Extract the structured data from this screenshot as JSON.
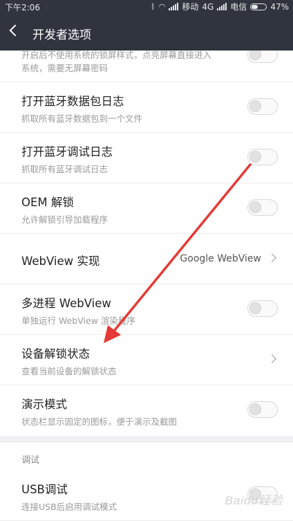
{
  "status_bar": {
    "time": "下午2:06",
    "carrier1": "移动",
    "network": "4G",
    "carrier2": "电信",
    "battery": "47%",
    "battery_level": 0.47
  },
  "header": {
    "title": "开发者选项"
  },
  "items": [
    {
      "sub_line1": "开启后不使用系统的锁屏样式，点亮屏幕直接进入",
      "sub_line2": "系统，需要无屏幕密码",
      "toggle": false
    },
    {
      "title": "打开蓝牙数据包日志",
      "subtitle": "抓取所有蓝牙数据包到一个文件",
      "toggle": false
    },
    {
      "title": "打开蓝牙调试日志",
      "subtitle": "抓取所有蓝牙调试日志",
      "toggle": false
    },
    {
      "title": "OEM 解锁",
      "subtitle": "允许解锁引导加载程序",
      "toggle": false
    },
    {
      "title": "WebView 实现",
      "value": "Google WebView"
    },
    {
      "title": "多进程 WebView",
      "subtitle": "单独运行 WebView 渲染程序",
      "toggle": false
    },
    {
      "title": "设备解锁状态",
      "subtitle": "查看当前设备的解锁状态"
    },
    {
      "title": "演示模式",
      "subtitle": "状态栏显示固定的图标，便于演示及截图",
      "toggle": false
    }
  ],
  "section": {
    "header": "调试"
  },
  "debug_items": [
    {
      "title": "USB调试",
      "subtitle": "连接USB后启用调试模式",
      "toggle": false
    }
  ],
  "watermark": "Baidu经验",
  "colors": {
    "header_bg": "#2f343f",
    "arrow": "#e53935"
  }
}
